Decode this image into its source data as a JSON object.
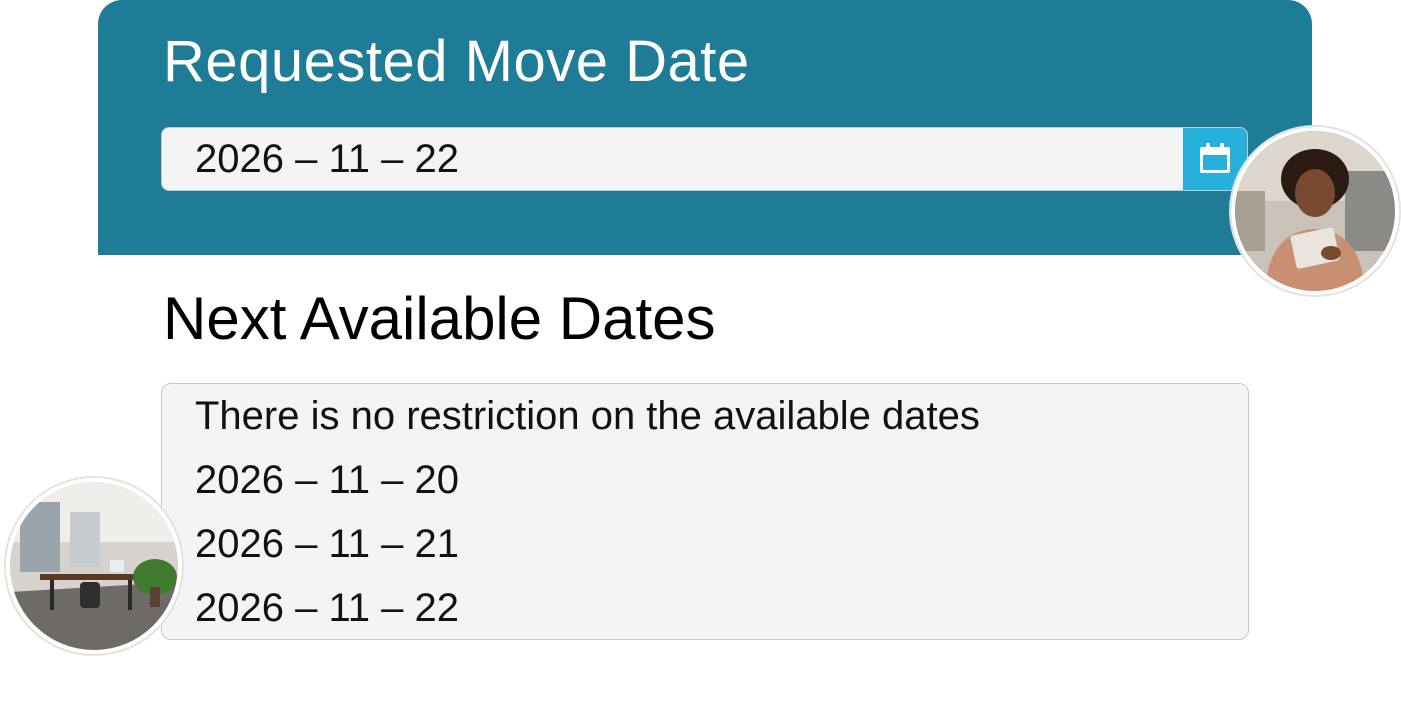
{
  "requested": {
    "title": "Requested Move Date",
    "date_value": "2026 – 11 – 22",
    "calendar_icon": "calendar-icon"
  },
  "available": {
    "title": "Next Available Dates",
    "items": [
      "There is no restriction on the available dates",
      "2026 – 11 – 20",
      "2026 – 11 – 21",
      "2026 – 11 – 22"
    ]
  },
  "colors": {
    "header_bg": "#1e7c97",
    "calendar_button_bg": "#27b0dc",
    "field_bg": "#f4f4f4"
  }
}
